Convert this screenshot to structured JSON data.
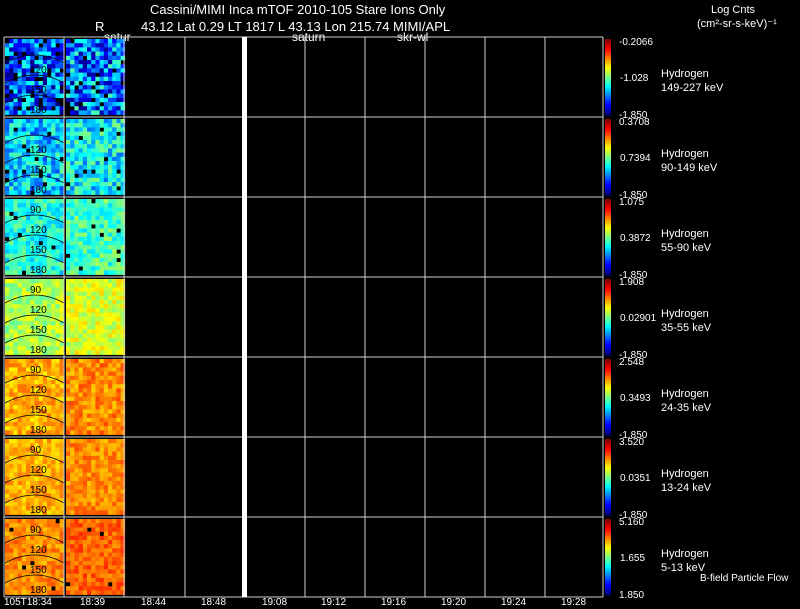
{
  "header": {
    "title": "Cassini/MIMI Inca mTOF  2010-105   Stare    Ions Only",
    "info_r": "R",
    "info_values": "43.12 Lat 0.29 LT 1817 L         43.13 Lon          215.74  MIMI/APL",
    "marker_left": "satur",
    "marker_mid": "saturn",
    "marker_right": "skr-wl",
    "units_line1": "Log Cnts",
    "units_line2": "(cm²-sr-s-keV)⁻¹"
  },
  "time_axis": {
    "labels": [
      "105T18:34",
      "18:39",
      "18:44",
      "18:48",
      "19:08",
      "19:12",
      "19:16",
      "19:20",
      "19:24",
      "19:28"
    ]
  },
  "footer": {
    "note": "B-field Particle Flow"
  },
  "panels": [
    {
      "species": "Hydrogen",
      "energy": "149-227 keV",
      "cb_top": "-0.2066",
      "cb_mid": "-1.028",
      "cb_bot": "-1.850",
      "scheme": "low",
      "angles": [
        "",
        "120",
        "150",
        "180"
      ]
    },
    {
      "species": "Hydrogen",
      "energy": "90-149 keV",
      "cb_top": "0.3708",
      "cb_mid": "0.7394",
      "cb_bot": "-1.850",
      "scheme": "lowmid",
      "angles": [
        "",
        "120",
        "150",
        "180"
      ]
    },
    {
      "species": "Hydrogen",
      "energy": "55-90 keV",
      "cb_top": "1.075",
      "cb_mid": "0.3872",
      "cb_bot": "-1.850",
      "scheme": "mid",
      "angles": [
        "90",
        "120",
        "150",
        "180"
      ]
    },
    {
      "species": "Hydrogen",
      "energy": "35-55 keV",
      "cb_top": "1.908",
      "cb_mid": "0.02901",
      "cb_bot": "-1.850",
      "scheme": "midhigh",
      "angles": [
        "90",
        "120",
        "150",
        "180"
      ]
    },
    {
      "species": "Hydrogen",
      "energy": "24-35 keV",
      "cb_top": "2.548",
      "cb_mid": "0.3493",
      "cb_bot": "-1.850",
      "scheme": "high",
      "angles": [
        "90",
        "120",
        "150",
        "180"
      ]
    },
    {
      "species": "Hydrogen",
      "energy": "13-24 keV",
      "cb_top": "3.520",
      "cb_mid": "0.0351",
      "cb_bot": "-1.850",
      "scheme": "high2",
      "angles": [
        "90",
        "120",
        "150",
        "180"
      ]
    },
    {
      "species": "Hydrogen",
      "energy": "5-13 keV",
      "cb_top": "5.160",
      "cb_mid": "1.655",
      "cb_bot": "1.850",
      "scheme": "high3",
      "angles": [
        "90",
        "120",
        "150",
        "180"
      ]
    }
  ]
}
